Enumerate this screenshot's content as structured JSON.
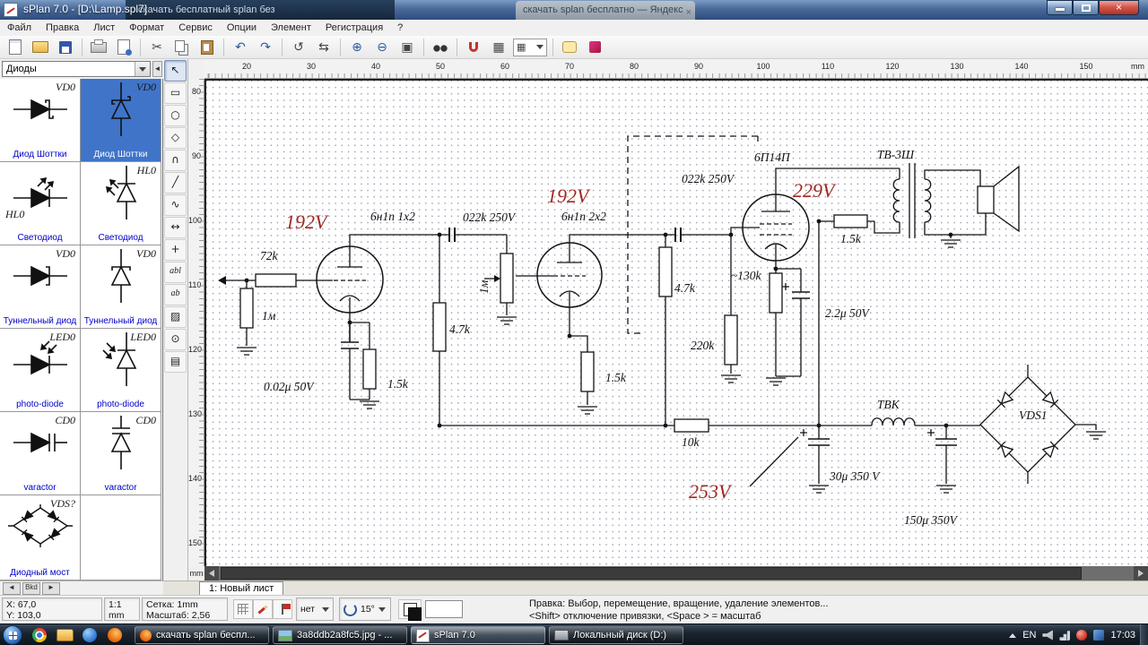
{
  "window": {
    "title": "sPlan 7.0 - [D:\\Lamp.spl7]",
    "bg_tab1": "скачать бесплатный splan без",
    "bg_tab2": "скачать splan бесплатно — Яндекс",
    "close_glyph": "×"
  },
  "menu": {
    "items": [
      "Файл",
      "Правка",
      "Лист",
      "Формат",
      "Сервис",
      "Опции",
      "Элемент",
      "Регистрация",
      "?"
    ]
  },
  "toolbar": {
    "icons": [
      "new",
      "open",
      "save",
      "print",
      "print-preview",
      "cut",
      "copy",
      "paste",
      "undo",
      "redo",
      "rotate",
      "mirror",
      "zoom-in",
      "zoom-out",
      "zoom-fit",
      "search",
      "magnet",
      "grid",
      "snap-mode",
      "comment",
      "element"
    ]
  },
  "library": {
    "selector": "Диоды",
    "collapse": "◄",
    "nav": {
      "prev": "◄",
      "label": "Bkd",
      "next": "►"
    },
    "items": [
      {
        "label": "VD0",
        "caption": "Диод Шоттки"
      },
      {
        "label": "VD0",
        "caption": "Диод Шоттки"
      },
      {
        "label": "HL0",
        "caption": "Светодиод"
      },
      {
        "label": "HL0",
        "caption": "Светодиод"
      },
      {
        "label": "VD0",
        "caption": "Туннельный диод"
      },
      {
        "label": "VD0",
        "caption": "Туннельный диод"
      },
      {
        "label": "LED0",
        "caption": "photo-diode"
      },
      {
        "label": "LED0",
        "caption": "photo-diode"
      },
      {
        "label": "CD0",
        "caption": "varactor"
      },
      {
        "label": "CD0",
        "caption": "varactor"
      },
      {
        "label": "VDS?",
        "caption": "Диодный мост"
      }
    ]
  },
  "tools": [
    {
      "name": "select",
      "glyph": "↖"
    },
    {
      "name": "rectangle",
      "glyph": "▭"
    },
    {
      "name": "ellipse",
      "glyph": "○"
    },
    {
      "name": "polygon",
      "glyph": "◇"
    },
    {
      "name": "arc",
      "glyph": "∩"
    },
    {
      "name": "line",
      "glyph": "╱"
    },
    {
      "name": "bezier",
      "glyph": "∿"
    },
    {
      "name": "dimension",
      "glyph": "↔"
    },
    {
      "name": "node",
      "glyph": "+"
    },
    {
      "name": "text",
      "glyph": "abl"
    },
    {
      "name": "textbox",
      "glyph": "ab"
    },
    {
      "name": "image",
      "glyph": "▨"
    },
    {
      "name": "zoom",
      "glyph": "⊙"
    },
    {
      "name": "measure",
      "glyph": "▤"
    }
  ],
  "rulers": {
    "unit": "mm",
    "top": [
      "20",
      "30",
      "40",
      "50",
      "60",
      "70",
      "80",
      "90",
      "100",
      "110",
      "120",
      "130",
      "140",
      "150"
    ],
    "left": [
      "80",
      "90",
      "100",
      "110",
      "120",
      "130",
      "140",
      "150"
    ]
  },
  "schematic": {
    "labels": [
      "192V",
      "192V",
      "229V",
      "253V",
      "72k",
      "6н1п 1x2",
      "022k 250V",
      "6н1п 2x2",
      "022k 250V",
      "6П14П",
      "ТВ-3Ш",
      "1м",
      "1м",
      "4.7k",
      "1.5k",
      "0.02μ 50V",
      "4.7k",
      "1.5k",
      "220k",
      "~130k",
      "1.5k",
      "2.2μ 50V",
      "10k",
      "ТВК",
      "VDS1",
      "30μ 350 V",
      "150μ 350V"
    ]
  },
  "sheet": {
    "tab": "1: Новый лист"
  },
  "statusbar": {
    "x": "X: 67,0",
    "y": "Y: 103,0",
    "ratio": "1:1",
    "unit": "mm",
    "grid": "Сетка: 1mm",
    "zoom": "Масштаб: 2,56",
    "snap": "нет",
    "angle": "15°",
    "help1": "Правка: Выбор, перемещение, вращение, удаление элементов...",
    "help2": "<Shift> отключение привязки, <Space > = масштаб"
  },
  "taskbar": {
    "buttons": [
      "скачать splan беспл...",
      "3a8ddb2a8fc5.jpg - ...",
      "sPlan 7.0",
      "Локальный диск (D:)"
    ],
    "tray": {
      "language": "EN",
      "time": "17:03"
    }
  }
}
